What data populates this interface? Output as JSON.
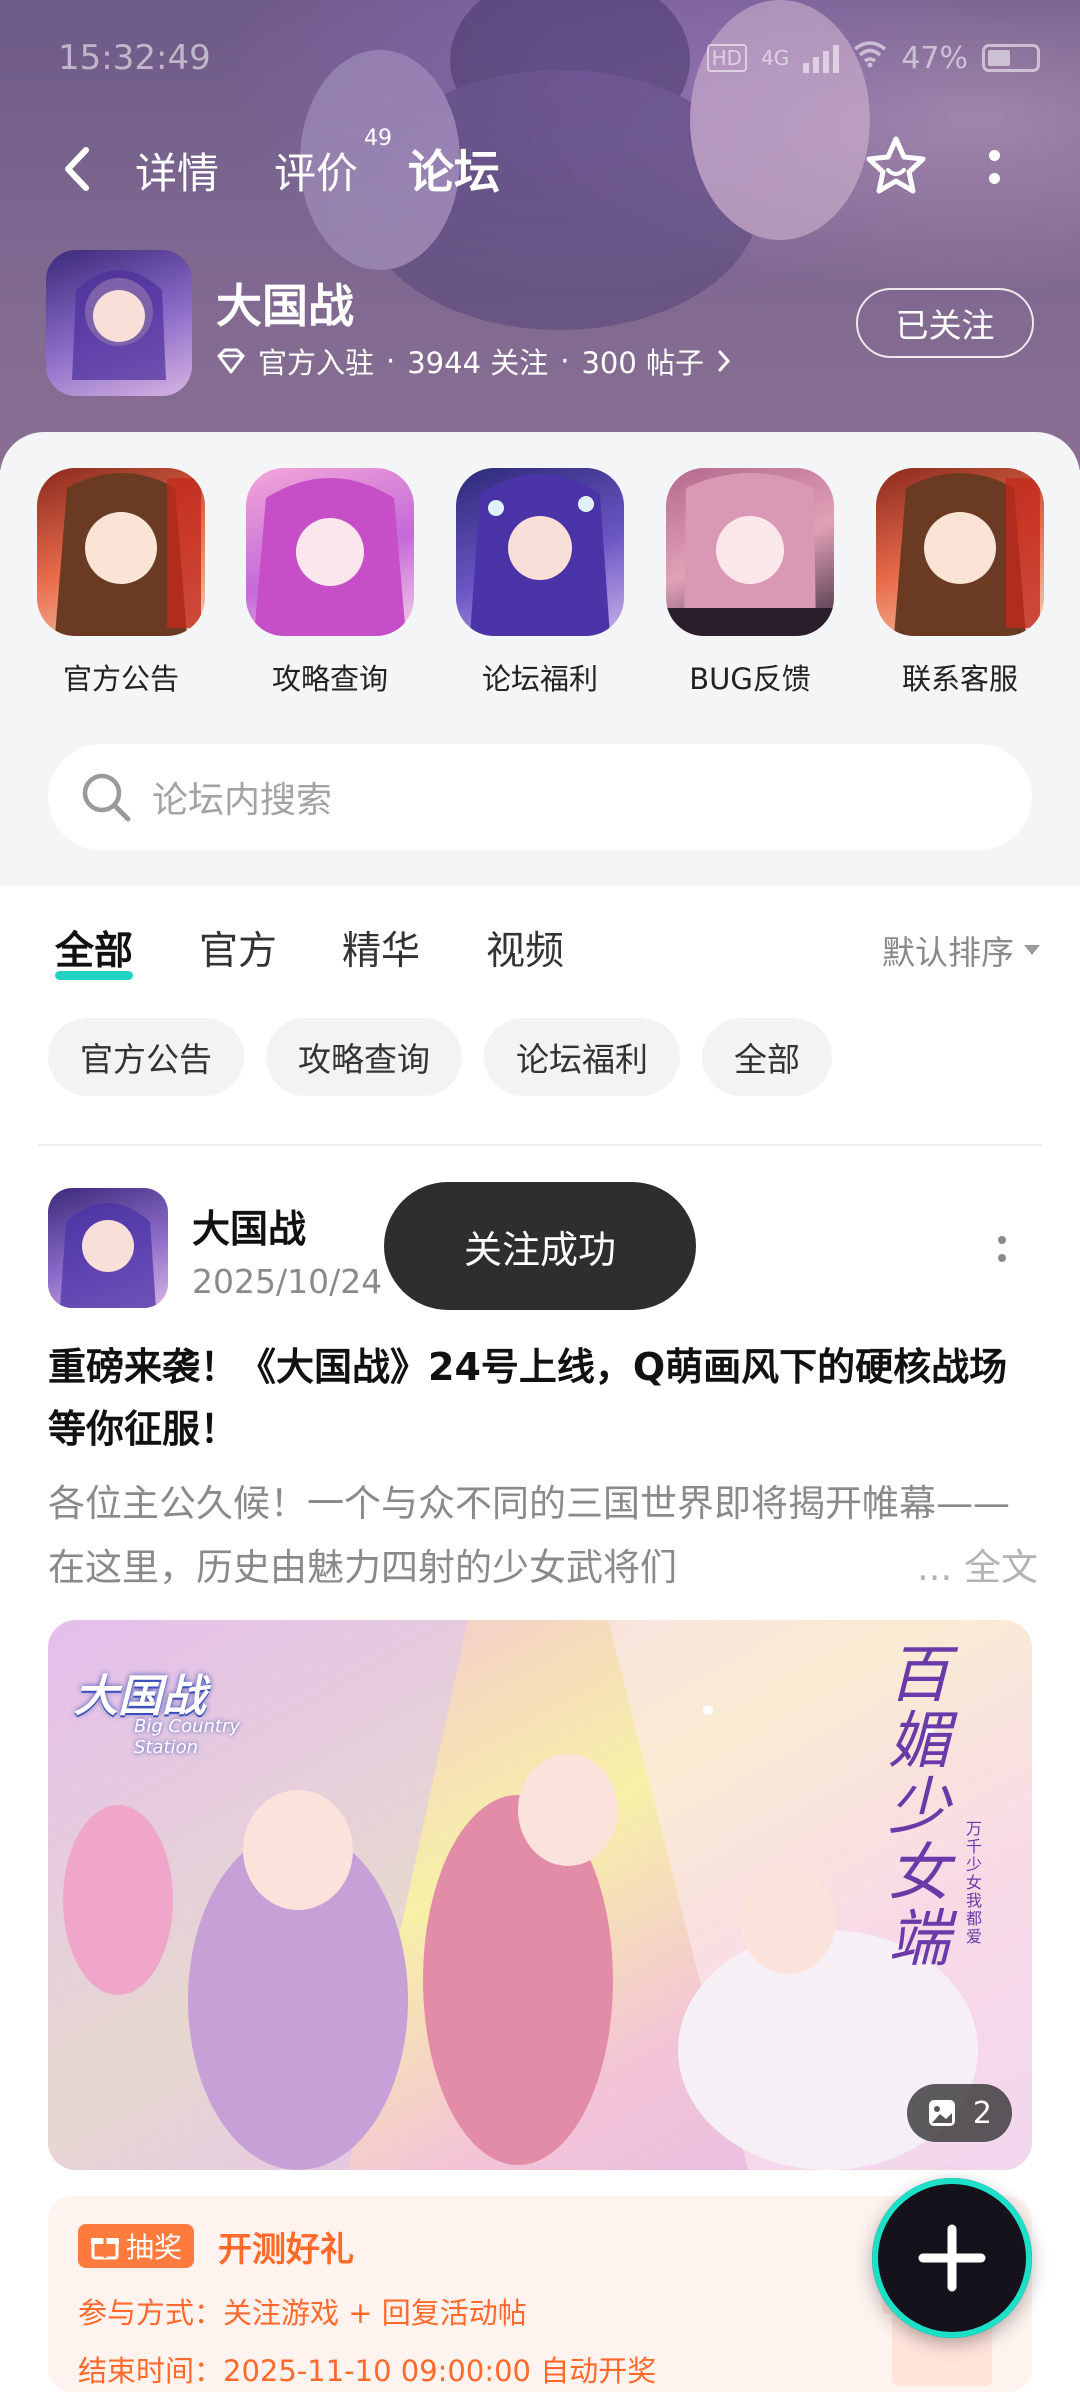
{
  "status_bar": {
    "time": "15:32:49",
    "network": "4G",
    "battery": "47%"
  },
  "nav": {
    "tabs": [
      "详情",
      "评价",
      "论坛"
    ],
    "review_count": "49"
  },
  "game": {
    "name": "大国战",
    "official": "官方入驻",
    "followers": "3944 关注",
    "posts": "300 帖子",
    "follow_button": "已关注"
  },
  "shortcuts": [
    {
      "label": "官方公告"
    },
    {
      "label": "攻略查询"
    },
    {
      "label": "论坛福利"
    },
    {
      "label": "BUG反馈"
    },
    {
      "label": "联系客服"
    }
  ],
  "search": {
    "placeholder": "论坛内搜索"
  },
  "filter_tabs": [
    "全部",
    "官方",
    "精华",
    "视频"
  ],
  "sort_label": "默认排序",
  "chips": [
    "官方公告",
    "攻略查询",
    "论坛福利",
    "全部"
  ],
  "post": {
    "author": "大国战",
    "date": "2025/10/24",
    "title": "重磅来袭！《大国战》24号上线，Q萌画风下的硬核战场等你征服！",
    "excerpt": "各位主公久候！一个与众不同的三国世界即将揭开帷幕——在这里，历史由魅力四射的少女武将们",
    "read_more": "... 全文",
    "image_count": "2",
    "image_text": {
      "logo": "大国战",
      "logo_en": "Big Country Station",
      "slogan": "百媚少女端",
      "slogan_small": "万千少女我都爱"
    }
  },
  "lottery": {
    "badge": "抽奖",
    "title": "开测好礼",
    "method": "参与方式：关注游戏 + 回复活动帖",
    "end_time": "结束时间：2025-11-10 09:00:00 自动开奖"
  },
  "toast": "关注成功",
  "colors": {
    "accent": "#22d3c5",
    "orange": "#ff6a2a",
    "toast_bg": "#2e2e2e"
  }
}
